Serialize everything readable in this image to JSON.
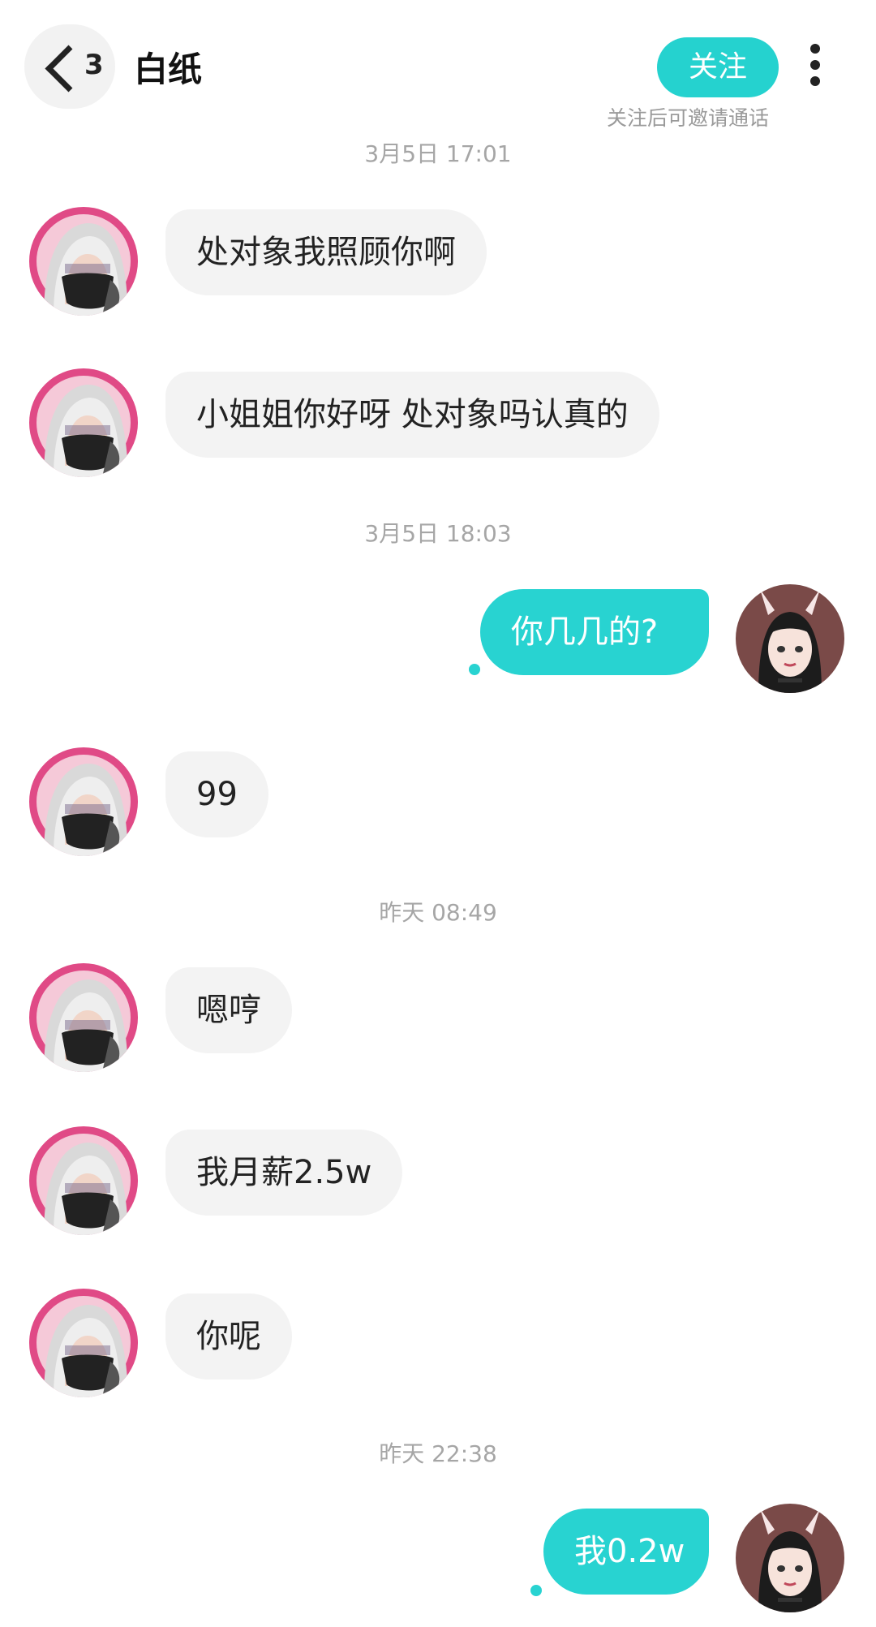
{
  "header": {
    "back_count": "3",
    "title": "白纸",
    "follow_label": "关注",
    "follow_hint": "关注后可邀请通话"
  },
  "messages": {
    "ts1": "3月5日 17:01",
    "m1": "处对象我照顾你啊",
    "m2": "小姐姐你好呀 处对象吗认真的",
    "ts2": "3月5日 18:03",
    "m3": "你几几的?",
    "m4": "99",
    "ts3": "昨天 08:49",
    "m5": "嗯哼",
    "m6": "我月薪2.5w",
    "m7": "你呢",
    "ts4": "昨天 22:38",
    "m8": "我0.2w"
  },
  "colors": {
    "accent": "#28d3d1",
    "incoming_bubble": "#f3f3f3",
    "timestamp": "#a6a6a6"
  },
  "icons": [
    "chevron-left-icon",
    "more-vertical-icon",
    "masked-avatar",
    "bunny-ear-avatar"
  ]
}
